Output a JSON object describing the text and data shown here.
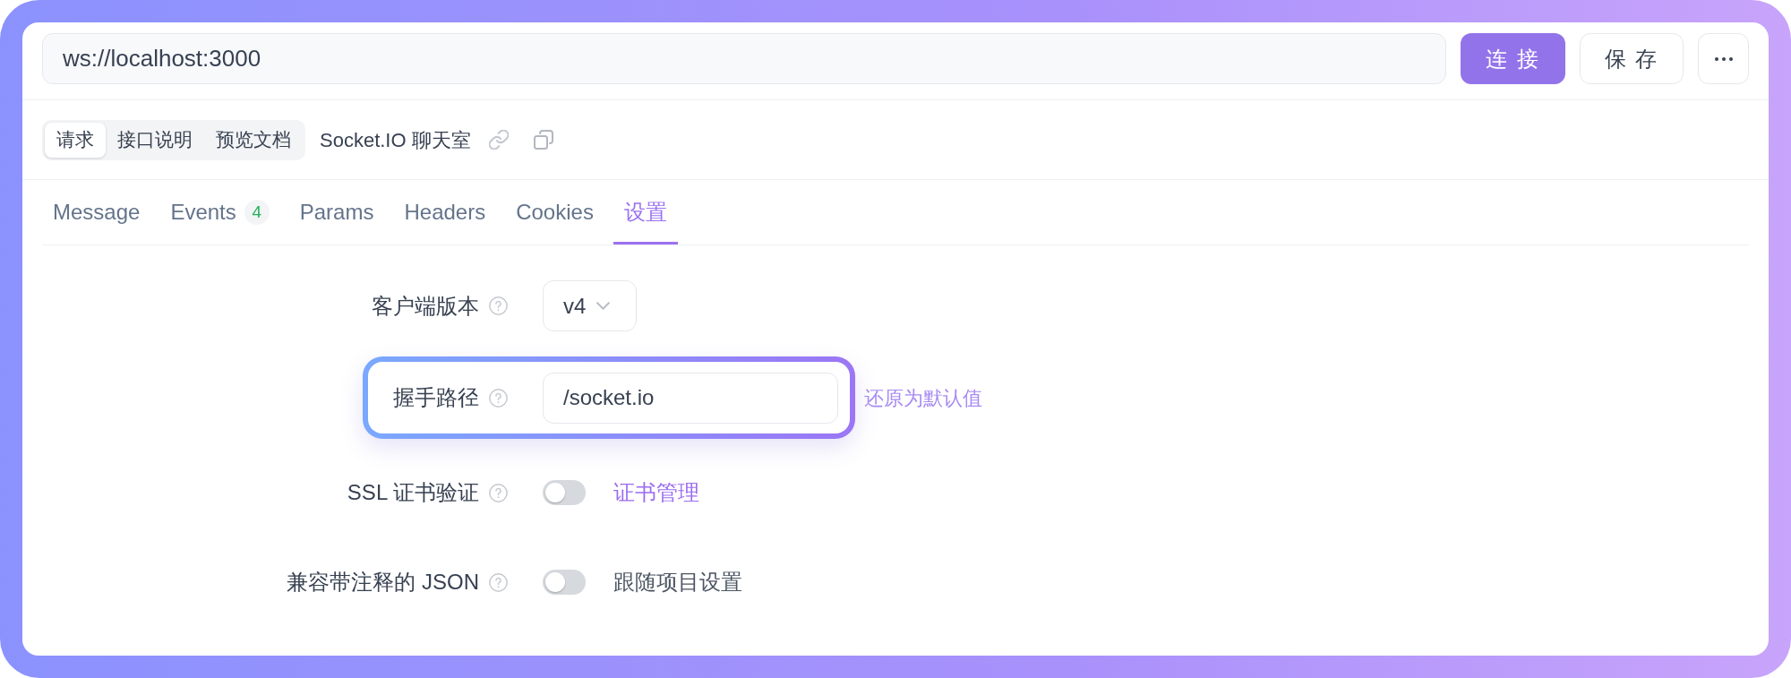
{
  "url_bar": {
    "value": "ws://localhost:3000"
  },
  "actions": [
    {
      "kind": "primary",
      "label": "连 接"
    },
    {
      "kind": "default",
      "label": "保 存"
    },
    {
      "kind": "more"
    }
  ],
  "doc_tabs": [
    {
      "label": "请求",
      "selected": true
    },
    {
      "label": "接口说明",
      "selected": false
    },
    {
      "label": "预览文档",
      "selected": false
    }
  ],
  "title": "Socket.IO 聊天室",
  "tabs": [
    {
      "label": "Message",
      "selected": false
    },
    {
      "label": "Events",
      "badge": "4",
      "selected": false
    },
    {
      "label": "Params",
      "selected": false
    },
    {
      "label": "Headers",
      "selected": false
    },
    {
      "label": "Cookies",
      "selected": false
    },
    {
      "label": "设置",
      "selected": true
    }
  ],
  "settings": [
    {
      "kind": "select",
      "label": "客户端版本",
      "value": "v4",
      "highlighted": false
    },
    {
      "kind": "input",
      "label": "握手路径",
      "value": "/socket.io",
      "highlighted": true,
      "extra": {
        "kind": "reset",
        "label": "还原为默认值"
      }
    },
    {
      "kind": "switch",
      "label": "SSL 证书验证",
      "on": false,
      "highlighted": false,
      "extra": {
        "kind": "link",
        "label": "证书管理"
      }
    },
    {
      "kind": "switch",
      "label": "兼容带注释的 JSON",
      "on": false,
      "highlighted": false,
      "extra": {
        "kind": "text",
        "label": "跟随项目设置"
      }
    }
  ]
}
